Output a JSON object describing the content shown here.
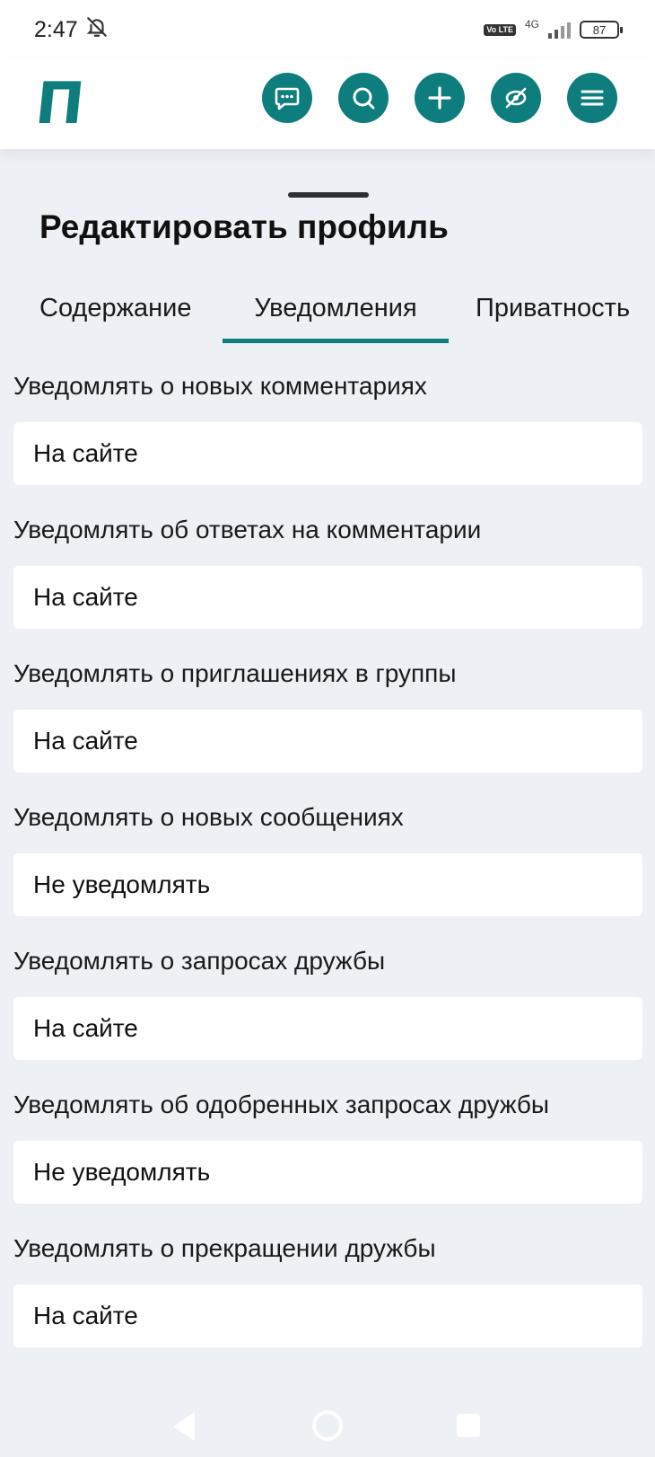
{
  "status_bar": {
    "time": "2:47",
    "network": "4G",
    "volte": "Vo LTE",
    "battery": "87"
  },
  "header": {
    "logo": "П",
    "actions": [
      "chat-icon",
      "search-icon",
      "add-icon",
      "hide-icon",
      "menu-icon"
    ]
  },
  "page": {
    "title": "Редактировать профиль",
    "tabs": [
      {
        "label": "Содержание",
        "active": false
      },
      {
        "label": "Уведомления",
        "active": true
      },
      {
        "label": "Приватность",
        "active": false
      }
    ]
  },
  "settings": [
    {
      "label": "Уведомлять о новых комментариях",
      "value": "На сайте"
    },
    {
      "label": "Уведомлять об ответах на комментарии",
      "value": "На сайте"
    },
    {
      "label": "Уведомлять о приглашениях в группы",
      "value": "На сайте"
    },
    {
      "label": "Уведомлять о новых сообщениях",
      "value": "Не уведомлять"
    },
    {
      "label": "Уведомлять о запросах дружбы",
      "value": "На сайте"
    },
    {
      "label": "Уведомлять об одобренных запросах дружбы",
      "value": "Не уведомлять"
    },
    {
      "label": "Уведомлять о прекращении дружбы",
      "value": "На сайте"
    }
  ],
  "colors": {
    "accent": "#0e7d7e",
    "background": "#edf0f5",
    "surface": "#ffffff"
  }
}
